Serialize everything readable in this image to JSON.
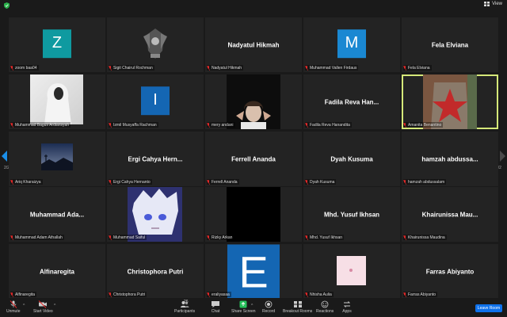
{
  "header": {
    "view_label": "View"
  },
  "participants": [
    {
      "name": "zoom baa04",
      "tile_text": "",
      "avatar": {
        "letter": "Z",
        "color": "#0f9aa0"
      }
    },
    {
      "name": "Sigit Chairul Rochman",
      "tile_text": "",
      "avatar": {
        "type": "emblem"
      }
    },
    {
      "name": "Nadyatul Hikmah",
      "tile_text": "Nadyatul Hikmah"
    },
    {
      "name": "Muhammad Vallen Firdaus",
      "tile_text": "",
      "avatar": {
        "letter": "M",
        "color": "#1a88d2"
      }
    },
    {
      "name": "Fela Elviana",
      "tile_text": "Fela Elviana"
    },
    {
      "name": "Muhammad Bagus Ardiansyah",
      "tile_text": "",
      "avatar": {
        "type": "photo-hoodie"
      }
    },
    {
      "name": "Izmil Musyaffa Rachman",
      "tile_text": "",
      "avatar": {
        "letter": "I",
        "color": "#1466b3"
      }
    },
    {
      "name": "mery andani",
      "tile_text": "",
      "avatar": {
        "type": "video-person"
      }
    },
    {
      "name": "Fadila Reva Hanandita",
      "tile_text": "Fadila Reva Han..."
    },
    {
      "name": "Amanita Benantino",
      "tile_text": "",
      "avatar": {
        "type": "photo-painting"
      }
    },
    {
      "name": "Ariq Kharaizya",
      "tile_text": "",
      "avatar": {
        "type": "photo-sunset"
      }
    },
    {
      "name": "Ergi Cahya Hernanto",
      "tile_text": "Ergi Cahya Hern..."
    },
    {
      "name": "Ferrell Ananda",
      "tile_text": "Ferrell Ananda"
    },
    {
      "name": "Dyah Kusuma",
      "tile_text": "Dyah Kusuma"
    },
    {
      "name": "hamzah abdussalam",
      "tile_text": "hamzah abdussa..."
    },
    {
      "name": "Muhammad Adam Athallah",
      "tile_text": "Muhammad Ada..."
    },
    {
      "name": "Muhammad Saiful",
      "tile_text": "",
      "avatar": {
        "type": "photo-anime"
      }
    },
    {
      "name": "Rizky Arkan",
      "tile_text": "",
      "avatar": {
        "type": "black"
      }
    },
    {
      "name": "Mhd. Yusuf Ikhsan",
      "tile_text": "Mhd. Yusuf Ikhsan"
    },
    {
      "name": "Khairunissa Maudina",
      "tile_text": "Khairunissa Mau..."
    },
    {
      "name": "Alfinaregita",
      "tile_text": "Alfinaregita"
    },
    {
      "name": "Christophora Putri",
      "tile_text": "Christophora Putri"
    },
    {
      "name": "eraliyasaa",
      "tile_text": "",
      "avatar": {
        "letter": "E",
        "color": "#1466b3"
      }
    },
    {
      "name": "Nhisha Aulia",
      "tile_text": "",
      "avatar": {
        "type": "photo-pink"
      }
    },
    {
      "name": "Farras Abiyanto",
      "tile_text": "Farras Abiyanto"
    }
  ],
  "active_speaker": "Amanita Benantino",
  "page": {
    "left": "2/2",
    "right": "2/2"
  },
  "toolbar": {
    "unmute": "Unmute",
    "start_video": "Start Video",
    "participants": "Participants",
    "participants_count": "26",
    "chat": "Chat",
    "share_screen": "Share Screen",
    "record": "Record",
    "breakout_rooms": "Breakout Rooms",
    "reactions": "Reactions",
    "apps": "Apps",
    "leave": "Leave Room"
  },
  "colors": {
    "accent": "#0e71eb",
    "share_green": "#26c15b",
    "active_border": "#d5e879",
    "muted_red": "#e02828"
  }
}
